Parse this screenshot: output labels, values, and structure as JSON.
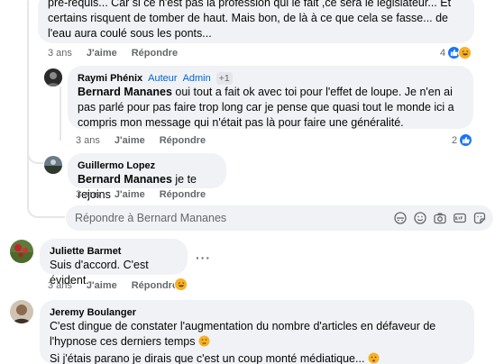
{
  "comments": [
    {
      "text": "pré-requis... Car si ce n'est pas la profession qui le fait ,ce sera le législateur... Et certains risquent de tomber de haut. Mais bon, de là à ce que cela se fasse... de l'eau aura coulé sous les ponts...",
      "time": "3 ans",
      "like_label": "J'aime",
      "reply_label": "Répondre",
      "reaction_count": "4",
      "reactions": [
        "like-icon",
        "haha-icon"
      ]
    },
    {
      "author": "Raymi Phénix",
      "badge_author": "Auteur",
      "badge_admin": "Admin",
      "badge_more": "+1",
      "mention": "Bernard Mananes",
      "text": " oui tout a fait ok avec toi pour l'effet de loupe. Je n'en ai pas parlé pour pas faire trop long car je pense que quasi tout le monde ici a compris mon message qui n'était pas là pour faire une généralité.",
      "time": "3 ans",
      "like_label": "J'aime",
      "reply_label": "Répondre",
      "reaction_count": "2",
      "reactions": [
        "like-icon"
      ]
    },
    {
      "author": "Guillermo Lopez",
      "mention": "Bernard Mananes",
      "text": " je te rejoins",
      "time": "3 ans",
      "like_label": "J'aime",
      "reply_label": "Répondre"
    },
    {
      "author": "Juliette Barmet",
      "text": "Suis d'accord. C'est évident.",
      "time": "3 ans",
      "like_label": "J'aime",
      "reply_label": "Répondre",
      "reactions": [
        "haha-icon"
      ]
    },
    {
      "author": "Jeremy Boulanger",
      "line1": "C'est dingue de constater l'augmentation du nombre d'articles en défaveur de",
      "line2": "l'hypnose ces derniers temps",
      "line3": "Si j'étais parano je dirais que c'est un coup monté médiatique..."
    }
  ],
  "reply_box": {
    "placeholder": "Répondre à Bernard Mananes",
    "tools": [
      "avatar-sticker-icon",
      "emoji-icon",
      "camera-icon",
      "gif-icon",
      "sticker-icon"
    ]
  },
  "colors": {
    "bubble": "#f0f2f5",
    "meta": "#65676b",
    "accent": "#0064d1",
    "like": "#1877f2"
  }
}
